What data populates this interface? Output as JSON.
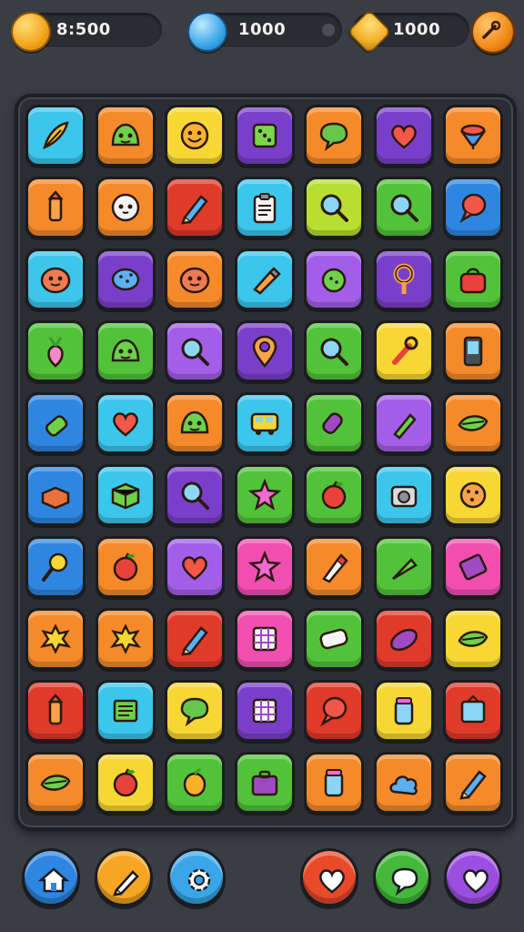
{
  "hud": {
    "coins": "8:500",
    "drops": "1000",
    "gems": "1000"
  },
  "colors": {
    "cyan": "#3cc6ec",
    "orange": "#f58a2a",
    "yellow": "#f6d734",
    "purple": "#7a3fc9",
    "green": "#52c23a",
    "red": "#e03a2a",
    "blue": "#2f86e0",
    "pink": "#f04fb0",
    "lime": "#b7df32",
    "violet": "#a35ee8"
  },
  "board": {
    "rows": [
      [
        {
          "c": "cyan",
          "icon": "feather-icon"
        },
        {
          "c": "orange",
          "icon": "slime-face-icon"
        },
        {
          "c": "yellow",
          "icon": "smiley-face-icon"
        },
        {
          "c": "purple",
          "icon": "dice-icon"
        },
        {
          "c": "orange",
          "icon": "speech-bubble-icon"
        },
        {
          "c": "purple",
          "icon": "heart-icon"
        },
        {
          "c": "orange",
          "icon": "spinning-top-icon"
        }
      ],
      [
        {
          "c": "orange",
          "icon": "crayon-icon"
        },
        {
          "c": "orange",
          "icon": "ghost-face-icon"
        },
        {
          "c": "red",
          "icon": "pencil-icon"
        },
        {
          "c": "cyan",
          "icon": "clipboard-icon"
        },
        {
          "c": "lime",
          "icon": "magnifier-icon"
        },
        {
          "c": "green",
          "icon": "magnifier-icon"
        },
        {
          "c": "blue",
          "icon": "balloon-icon"
        }
      ],
      [
        {
          "c": "cyan",
          "icon": "blob-face-icon"
        },
        {
          "c": "purple",
          "icon": "fish-icon"
        },
        {
          "c": "orange",
          "icon": "blob-face-icon"
        },
        {
          "c": "cyan",
          "icon": "paint-tube-icon"
        },
        {
          "c": "violet",
          "icon": "lime-icon"
        },
        {
          "c": "purple",
          "icon": "key-ring-icon"
        },
        {
          "c": "green",
          "icon": "bag-icon"
        }
      ],
      [
        {
          "c": "green",
          "icon": "radish-icon"
        },
        {
          "c": "green",
          "icon": "slime-face-icon"
        },
        {
          "c": "violet",
          "icon": "magnifier-icon"
        },
        {
          "c": "purple",
          "icon": "map-pin-icon"
        },
        {
          "c": "green",
          "icon": "magnifier-icon"
        },
        {
          "c": "yellow",
          "icon": "wrench-icon"
        },
        {
          "c": "orange",
          "icon": "phone-icon"
        }
      ],
      [
        {
          "c": "blue",
          "icon": "bottle-icon"
        },
        {
          "c": "cyan",
          "icon": "heart-icon"
        },
        {
          "c": "orange",
          "icon": "slime-face-icon"
        },
        {
          "c": "cyan",
          "icon": "bus-icon"
        },
        {
          "c": "green",
          "icon": "candy-icon"
        },
        {
          "c": "violet",
          "icon": "marker-icon"
        },
        {
          "c": "orange",
          "icon": "leaf-icon"
        }
      ],
      [
        {
          "c": "blue",
          "icon": "brick-icon"
        },
        {
          "c": "cyan",
          "icon": "cube-icon"
        },
        {
          "c": "purple",
          "icon": "magnifier-icon"
        },
        {
          "c": "green",
          "icon": "star-icon"
        },
        {
          "c": "green",
          "icon": "apple-icon"
        },
        {
          "c": "cyan",
          "icon": "camera-icon"
        },
        {
          "c": "yellow",
          "icon": "cookie-icon"
        }
      ],
      [
        {
          "c": "blue",
          "icon": "mirror-icon"
        },
        {
          "c": "orange",
          "icon": "apple-icon"
        },
        {
          "c": "violet",
          "icon": "heart-icon"
        },
        {
          "c": "pink",
          "icon": "star-icon"
        },
        {
          "c": "orange",
          "icon": "pen-tip-icon"
        },
        {
          "c": "green",
          "icon": "carrot-icon"
        },
        {
          "c": "pink",
          "icon": "ticket-icon"
        }
      ],
      [
        {
          "c": "orange",
          "icon": "splat-icon"
        },
        {
          "c": "orange",
          "icon": "splat-icon"
        },
        {
          "c": "red",
          "icon": "pencil-icon"
        },
        {
          "c": "pink",
          "icon": "grid-icon"
        },
        {
          "c": "green",
          "icon": "scroll-icon"
        },
        {
          "c": "red",
          "icon": "eggplant-icon"
        },
        {
          "c": "yellow",
          "icon": "leaf-icon"
        }
      ],
      [
        {
          "c": "red",
          "icon": "crayon-icon"
        },
        {
          "c": "cyan",
          "icon": "book-icon"
        },
        {
          "c": "yellow",
          "icon": "speech-bubble-icon"
        },
        {
          "c": "purple",
          "icon": "grid-icon"
        },
        {
          "c": "red",
          "icon": "balloon-icon"
        },
        {
          "c": "yellow",
          "icon": "jar-icon"
        },
        {
          "c": "red",
          "icon": "frame-icon"
        }
      ],
      [
        {
          "c": "orange",
          "icon": "leaf-icon"
        },
        {
          "c": "yellow",
          "icon": "apple-icon"
        },
        {
          "c": "green",
          "icon": "mango-icon"
        },
        {
          "c": "green",
          "icon": "briefcase-icon"
        },
        {
          "c": "orange",
          "icon": "jar-icon"
        },
        {
          "c": "orange",
          "icon": "cloud-icon"
        },
        {
          "c": "orange",
          "icon": "pencil-icon"
        }
      ]
    ]
  },
  "bottom_bar": {
    "left": [
      {
        "name": "home-button",
        "icon": "house-icon",
        "c": "#2f86e0"
      },
      {
        "name": "draw-button",
        "icon": "pencil-icon",
        "c": "#f6a623"
      },
      {
        "name": "settings-button",
        "icon": "gear-icon",
        "c": "#3aa6e8"
      }
    ],
    "right": [
      {
        "name": "favorites-button",
        "icon": "heart-icon",
        "c": "#e84a2a"
      },
      {
        "name": "chat-button",
        "icon": "speech-heart-icon",
        "c": "#43b83a"
      },
      {
        "name": "like-button",
        "icon": "heart-icon",
        "c": "#9b4fe0"
      }
    ]
  }
}
